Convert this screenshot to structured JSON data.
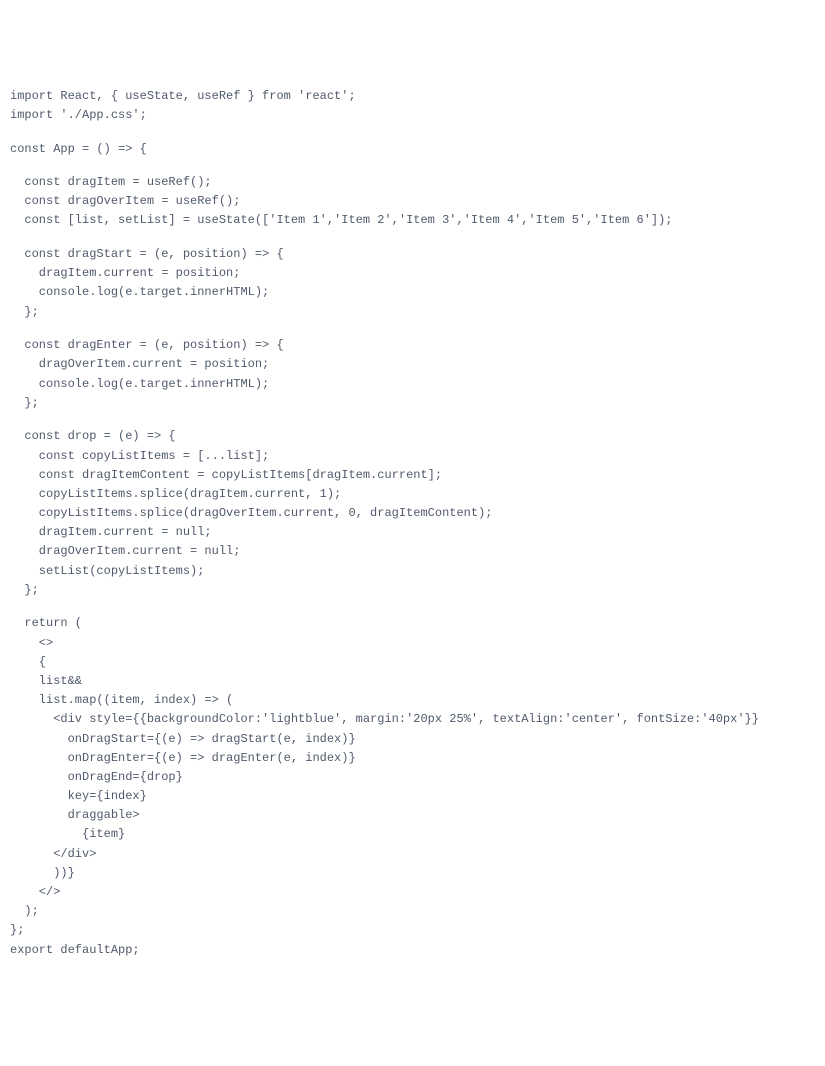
{
  "code": {
    "lines": [
      "import React, { useState, useRef } from 'react';",
      "import './App.css';",
      "",
      "const App = () => {",
      "",
      "  const dragItem = useRef();",
      "  const dragOverItem = useRef();",
      "  const [list, setList] = useState(['Item 1','Item 2','Item 3','Item 4','Item 5','Item 6']);",
      "",
      "  const dragStart = (e, position) => {",
      "    dragItem.current = position;",
      "    console.log(e.target.innerHTML);",
      "  };",
      "",
      "  const dragEnter = (e, position) => {",
      "    dragOverItem.current = position;",
      "    console.log(e.target.innerHTML);",
      "  };",
      "",
      "  const drop = (e) => {",
      "    const copyListItems = [...list];",
      "    const dragItemContent = copyListItems[dragItem.current];",
      "    copyListItems.splice(dragItem.current, 1);",
      "    copyListItems.splice(dragOverItem.current, 0, dragItemContent);",
      "    dragItem.current = null;",
      "    dragOverItem.current = null;",
      "    setList(copyListItems);",
      "  };",
      "",
      "  return (",
      "    <>",
      "    {",
      "    list&&",
      "    list.map((item, index) => (",
      "      <div style={{backgroundColor:'lightblue', margin:'20px 25%', textAlign:'center', fontSize:'40px'}}",
      "        onDragStart={(e) => dragStart(e, index)}",
      "        onDragEnter={(e) => dragEnter(e, index)}",
      "        onDragEnd={drop}",
      "        key={index}",
      "        draggable>",
      "          {item}",
      "      </div>",
      "      ))}",
      "    </>",
      "  );",
      "};",
      "export defaultApp;"
    ]
  }
}
